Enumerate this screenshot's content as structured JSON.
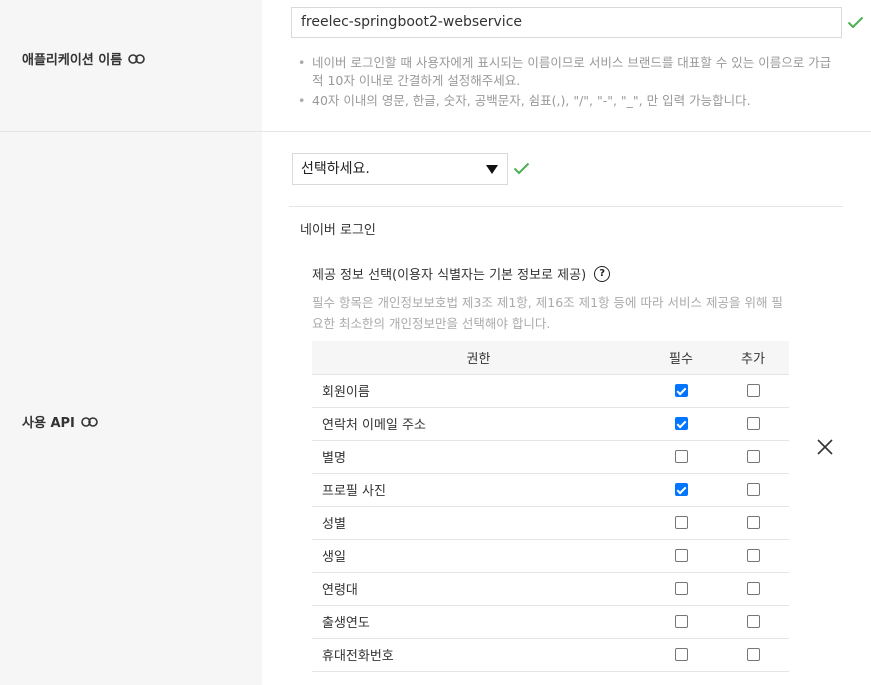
{
  "app_name_row": {
    "label": "애플리케이션 이름",
    "input_value": "freelec-springboot2-webservice",
    "help": [
      "네이버 로그인할 때 사용자에게 표시되는 이름이므로 서비스 브랜드를 대표할 수 있는 이름으로 가급적 10자 이내로 간결하게 설정해주세요.",
      "40자 이내의 영문, 한글, 숫자, 공백문자, 쉼표(,), \"/\", \"-\", \"_\", 만 입력 가능합니다."
    ]
  },
  "api_row": {
    "label": "사용 API",
    "select_value": "선택하세요.",
    "section_title": "네이버 로그인",
    "perm_title": "제공 정보 선택(이용자 식별자는 기본 정보로 제공)",
    "help_symbol": "?",
    "perm_note": "필수 항목은 개인정보보호법 제3조 제1항, 제16조 제1항 등에 따라 서비스 제공을 위해 필요한 최소한의 개인정보만을 선택해야 합니다.",
    "table": {
      "headers": [
        "권한",
        "필수",
        "추가"
      ],
      "rows": [
        {
          "name": "회원이름",
          "required": true,
          "optional": false
        },
        {
          "name": "연락처 이메일 주소",
          "required": true,
          "optional": false
        },
        {
          "name": "별명",
          "required": false,
          "optional": false
        },
        {
          "name": "프로필 사진",
          "required": true,
          "optional": false
        },
        {
          "name": "성별",
          "required": false,
          "optional": false
        },
        {
          "name": "생일",
          "required": false,
          "optional": false
        },
        {
          "name": "연령대",
          "required": false,
          "optional": false
        },
        {
          "name": "출생연도",
          "required": false,
          "optional": false
        },
        {
          "name": "휴대전화번호",
          "required": false,
          "optional": false
        }
      ]
    }
  },
  "icons": {
    "link": "link-icon",
    "valid": "check-icon",
    "remove": "close-icon"
  },
  "colors": {
    "check_green": "#4caf50",
    "checkbox_blue": "#0075ff",
    "label_panel": "#f6f6f6"
  }
}
